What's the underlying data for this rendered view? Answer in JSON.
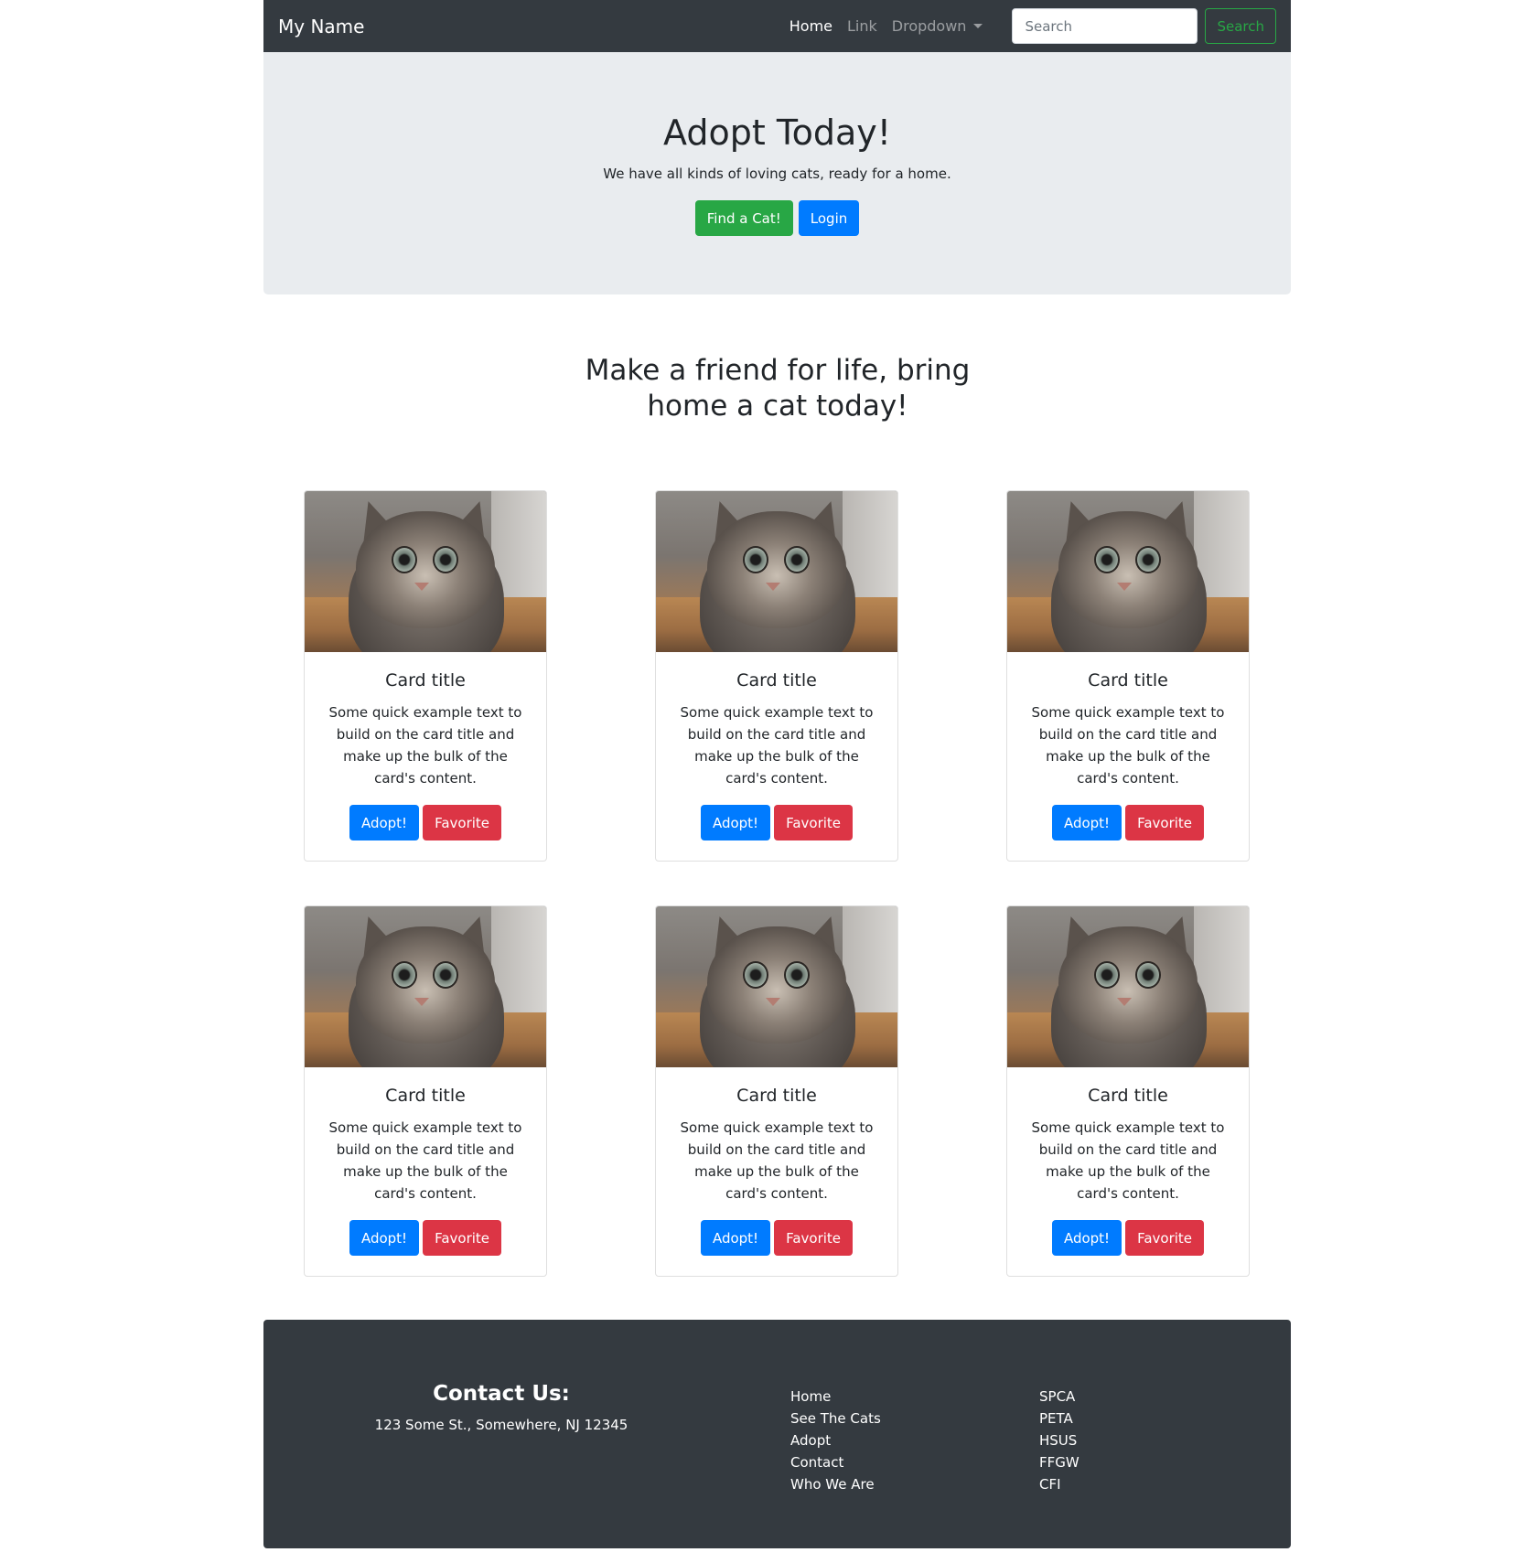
{
  "navbar": {
    "brand": "My Name",
    "links": [
      "Home",
      "Link",
      "Dropdown"
    ],
    "search_placeholder": "Search",
    "search_button": "Search"
  },
  "hero": {
    "title": "Adopt Today!",
    "lead": "We have all kinds of loving cats, ready for a home.",
    "primary_button": "Find a Cat!",
    "secondary_button": "Login"
  },
  "tagline": "Make a friend for life, bring home a cat today!",
  "cards": [
    {
      "title": "Card title",
      "text": "Some quick example text to build on the card title and make up the bulk of the card's content.",
      "adopt": "Adopt!",
      "favorite": "Favorite"
    },
    {
      "title": "Card title",
      "text": "Some quick example text to build on the card title and make up the bulk of the card's content.",
      "adopt": "Adopt!",
      "favorite": "Favorite"
    },
    {
      "title": "Card title",
      "text": "Some quick example text to build on the card title and make up the bulk of the card's content.",
      "adopt": "Adopt!",
      "favorite": "Favorite"
    },
    {
      "title": "Card title",
      "text": "Some quick example text to build on the card title and make up the bulk of the card's content.",
      "adopt": "Adopt!",
      "favorite": "Favorite"
    },
    {
      "title": "Card title",
      "text": "Some quick example text to build on the card title and make up the bulk of the card's content.",
      "adopt": "Adopt!",
      "favorite": "Favorite"
    },
    {
      "title": "Card title",
      "text": "Some quick example text to build on the card title and make up the bulk of the card's content.",
      "adopt": "Adopt!",
      "favorite": "Favorite"
    }
  ],
  "footer": {
    "contact_heading": "Contact Us:",
    "address": "123 Some St., Somewhere, NJ 12345",
    "links": [
      "Home",
      "See The Cats",
      "Adopt",
      "Contact",
      "Who We Are"
    ],
    "orgs": [
      "SPCA",
      "PETA",
      "HSUS",
      "FFGW",
      "CFI"
    ]
  },
  "colors": {
    "dark": "#343a40",
    "light_gray": "#e9ecef",
    "success": "#28a745",
    "primary": "#007bff",
    "danger": "#dc3545"
  }
}
